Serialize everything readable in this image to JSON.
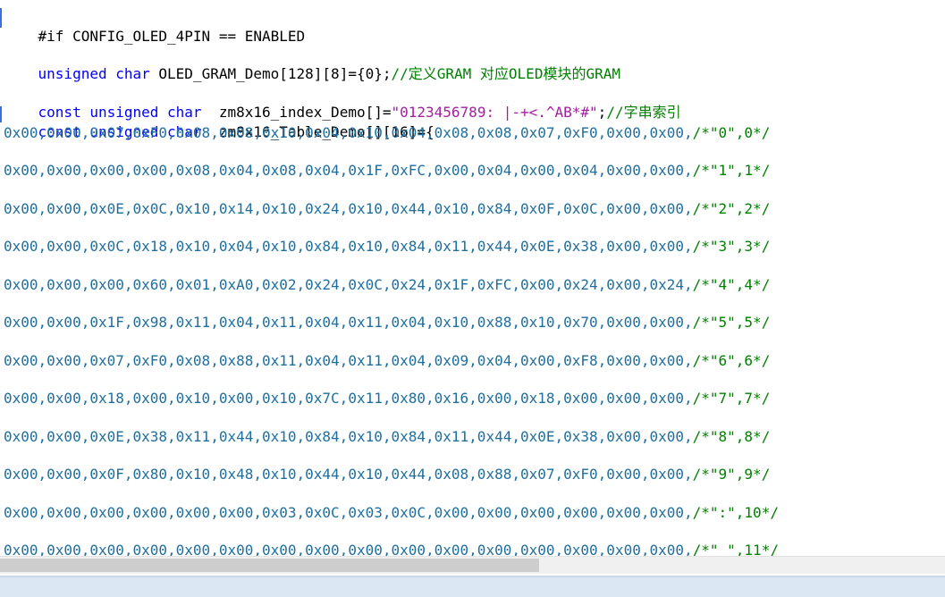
{
  "code": {
    "line_if": "#if CONFIG_OLED_4PIN == ENABLED",
    "gram_kw": "unsigned char",
    "gram_decl": " OLED_GRAM_Demo[128][8]={0};",
    "gram_comment": "//定义GRAM 对应OLED模块的GRAM",
    "index_kw": "const unsigned char",
    "index_decl": "  zm8x16_index_Demo[]=",
    "index_str": "\"0123456789: |-+<.^AB*#\"",
    "index_end": ";",
    "index_comment": "//字串索引",
    "table_kw": "const unsigned char",
    "table_decl": "  zm8x16_Table_Demo[][16]={",
    "rows": [
      {
        "hex": "0x00,0x00,0x07,0xF0,0x08,0x08,0x10,0x04,0x10,0x04,0x08,0x08,0x07,0xF0,0x00,0x00,",
        "comment": "/*\"0\",0*/"
      },
      {
        "hex": "0x00,0x00,0x00,0x00,0x08,0x04,0x08,0x04,0x1F,0xFC,0x00,0x04,0x00,0x04,0x00,0x00,",
        "comment": "/*\"1\",1*/"
      },
      {
        "hex": "0x00,0x00,0x0E,0x0C,0x10,0x14,0x10,0x24,0x10,0x44,0x10,0x84,0x0F,0x0C,0x00,0x00,",
        "comment": "/*\"2\",2*/"
      },
      {
        "hex": "0x00,0x00,0x0C,0x18,0x10,0x04,0x10,0x84,0x10,0x84,0x11,0x44,0x0E,0x38,0x00,0x00,",
        "comment": "/*\"3\",3*/"
      },
      {
        "hex": "0x00,0x00,0x00,0x60,0x01,0xA0,0x02,0x24,0x0C,0x24,0x1F,0xFC,0x00,0x24,0x00,0x24,",
        "comment": "/*\"4\",4*/"
      },
      {
        "hex": "0x00,0x00,0x1F,0x98,0x11,0x04,0x11,0x04,0x11,0x04,0x10,0x88,0x10,0x70,0x00,0x00,",
        "comment": "/*\"5\",5*/"
      },
      {
        "hex": "0x00,0x00,0x07,0xF0,0x08,0x88,0x11,0x04,0x11,0x04,0x09,0x04,0x00,0xF8,0x00,0x00,",
        "comment": "/*\"6\",6*/"
      },
      {
        "hex": "0x00,0x00,0x18,0x00,0x10,0x00,0x10,0x7C,0x11,0x80,0x16,0x00,0x18,0x00,0x00,0x00,",
        "comment": "/*\"7\",7*/"
      },
      {
        "hex": "0x00,0x00,0x0E,0x38,0x11,0x44,0x10,0x84,0x10,0x84,0x11,0x44,0x0E,0x38,0x00,0x00,",
        "comment": "/*\"8\",8*/"
      },
      {
        "hex": "0x00,0x00,0x0F,0x80,0x10,0x48,0x10,0x44,0x10,0x44,0x08,0x88,0x07,0xF0,0x00,0x00,",
        "comment": "/*\"9\",9*/"
      },
      {
        "hex": "0x00,0x00,0x00,0x00,0x00,0x00,0x03,0x0C,0x03,0x0C,0x00,0x00,0x00,0x00,0x00,0x00,",
        "comment": "/*\":\",10*/"
      },
      {
        "hex": "0x00,0x00,0x00,0x00,0x00,0x00,0x00,0x00,0x00,0x00,0x00,0x00,0x00,0x00,0x00,0x00,",
        "comment": "/*\" \",11*/"
      }
    ]
  },
  "colors": {
    "keyword": "#0000ff",
    "string": "#a31fa0",
    "comment": "#008000",
    "hex_literal": "#1e6f9f",
    "line_marker": "#3b6fe0"
  }
}
